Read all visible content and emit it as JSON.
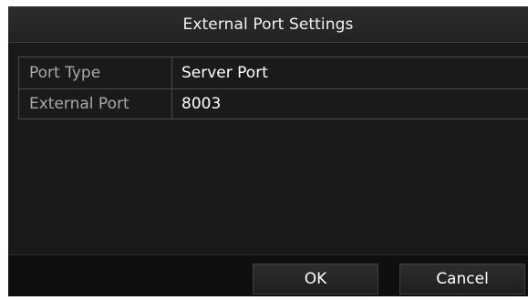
{
  "dialog": {
    "title": "External Port Settings"
  },
  "fields": [
    {
      "label": "Port Type",
      "value": "Server Port"
    },
    {
      "label": "External Port",
      "value": "8003"
    }
  ],
  "buttons": {
    "ok_label": "OK",
    "cancel_label": "Cancel"
  },
  "colors": {
    "dialog_background": "#1a1a1a",
    "label_text": "#a9a9a9",
    "value_text": "#ffffff",
    "grid_line": "#4a4a4a"
  }
}
